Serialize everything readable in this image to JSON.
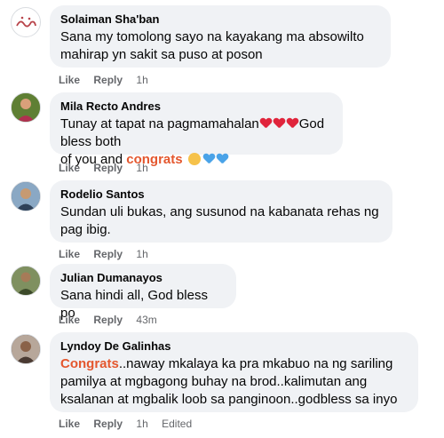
{
  "comments": [
    {
      "name": "Solaiman Sha'ban",
      "lines": [
        "Sana my tomolong sayo na kayakang ma absowilto",
        "mahirap yn sakit sa puso at poson"
      ],
      "like": "Like",
      "reply": "Reply",
      "time": "1h"
    },
    {
      "name": "Mila Recto Andres",
      "line1": "Tunay at tapat na pagmamahalan",
      "line1_after": "God bless both",
      "line2_before": "of you and ",
      "line2_highlight": "congrats",
      "like": "Like",
      "reply": "Reply",
      "time": "1h"
    },
    {
      "name": "Rodelio Santos",
      "lines": [
        "Sundan uli bukas, ang susunod na kabanata rehas ng",
        "pag ibig."
      ],
      "like": "Like",
      "reply": "Reply",
      "time": "1h"
    },
    {
      "name": "Julian Dumanayos",
      "lines": [
        "Sana hindi all, God bless po"
      ],
      "like": "Like",
      "reply": "Reply",
      "time": "43m"
    },
    {
      "name": "Lyndoy De Galinhas",
      "line1_highlight": "Congrats",
      "line1_rest": "..naway mkalaya ka pra mkabuo na ng sariling",
      "lines": [
        "pamilya at mgbagong buhay na brod..kalimutan ang",
        "ksalanan at mgbalik loob sa panginoon..godbless sa inyo"
      ],
      "like": "Like",
      "reply": "Reply",
      "time": "1h",
      "edited": "Edited"
    }
  ],
  "colors": {
    "bubble": "#f0f2f5",
    "meta": "#65676b",
    "highlight": "#e4572e"
  }
}
